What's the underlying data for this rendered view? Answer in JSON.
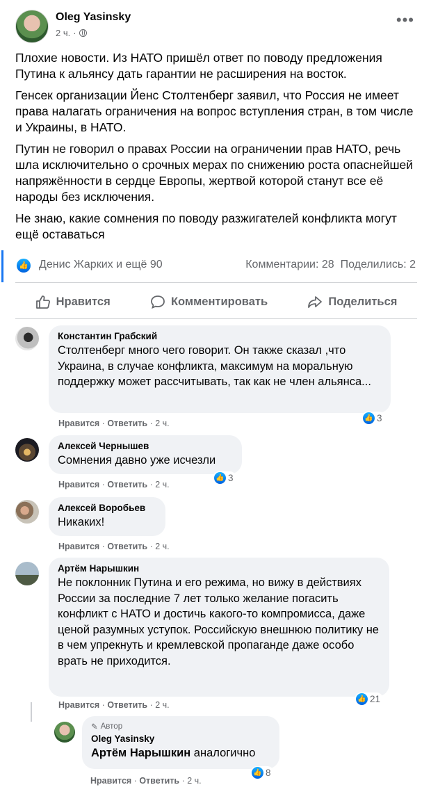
{
  "post": {
    "author": "Oleg Yasinsky",
    "time": "2 ч.",
    "more_icon": "•••",
    "paragraphs": [
      "Плохие новости. Из НАТО пришёл ответ по поводу предложения Путина к альянсу дать гарантии не расширения на восток.",
      "Генсек организации Йенс Столтенберг заявил, что Россия не имеет права налагать ограничения на вопрос вступления стран, в том числе и Украины, в НАТО.",
      "Путин не говорил о правах России на ограничении прав НАТО, речь шла исключительно о срочных мерах по снижению роста опаснейшей напряжённости в сердце Европы, жертвой которой станут все её народы без исключения.",
      "Не знаю, какие сомнения по поводу разжигателей конфликта могут ещё оставаться"
    ],
    "reactors": "Денис Жарких и ещё 90",
    "comments_count": "Комментарии: 28",
    "shares_count": "Поделились: 2"
  },
  "actions": {
    "like": "Нравится",
    "comment": "Комментировать",
    "share": "Поделиться"
  },
  "comment_actions": {
    "like": "Нравится",
    "reply": "Ответить",
    "sep": "·"
  },
  "comments": [
    {
      "name": "Константин Грабский",
      "text": "Столтенберг много чего говорит. Он также сказал ,что Украина, в случае конфликта, максимум на моральную поддержку может рассчитывать, так как не член альянса...",
      "time": "2 ч.",
      "reactions": "3"
    },
    {
      "name": "Алексей Чернышев",
      "text": "Сомнения давно уже исчезли",
      "time": "2 ч.",
      "reactions": "3"
    },
    {
      "name": "Алексей Воробьев",
      "text": "Никаких!",
      "time": "2 ч.",
      "reactions": ""
    },
    {
      "name": "Артём Нарышкин",
      "text": "Не поклонник Путина и его режима, но вижу в действиях России за последние 7 лет только желание погасить конфликт с НАТО и достичь какого-то компромисса, даже ценой разумных уступок. Российскую внешнюю политику не в чем упрекнуть и кремлевской пропаганде даже особо врать не приходится.",
      "time": "2 ч.",
      "reactions": "21"
    }
  ],
  "reply": {
    "badge": "Автор",
    "name": "Oleg Yasinsky",
    "mention": "Артём Нарышкин",
    "text": " аналогично",
    "time": "2 ч.",
    "reactions": "8"
  },
  "colors": {
    "accent": "#1877f2",
    "secondary_text": "#65676b",
    "bubble": "#f0f2f5"
  }
}
